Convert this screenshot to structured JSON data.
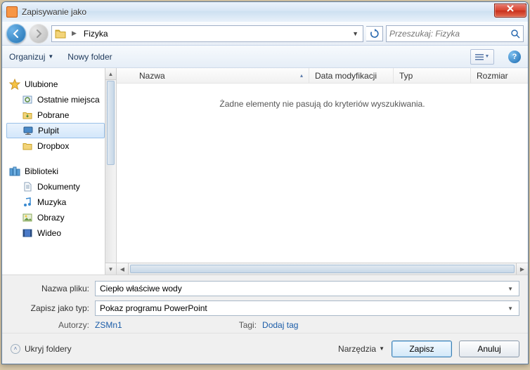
{
  "window": {
    "title": "Zapisywanie jako"
  },
  "address": {
    "path": "Fizyka"
  },
  "search": {
    "placeholder": "Przeszukaj: Fizyka"
  },
  "toolbar": {
    "organize": "Organizuj",
    "new_folder": "Nowy folder"
  },
  "sidebar": {
    "favorites": {
      "label": "Ulubione",
      "items": [
        "Ostatnie miejsca",
        "Pobrane",
        "Pulpit",
        "Dropbox"
      ]
    },
    "libraries": {
      "label": "Biblioteki",
      "items": [
        "Dokumenty",
        "Muzyka",
        "Obrazy",
        "Wideo"
      ]
    }
  },
  "columns": {
    "name": "Nazwa",
    "modified": "Data modyfikacji",
    "type": "Typ",
    "size": "Rozmiar"
  },
  "listing": {
    "empty_message": "Żadne elementy nie pasują do kryteriów wyszukiwania."
  },
  "form": {
    "filename_label": "Nazwa pliku:",
    "filename_value": "Ciepło właściwe wody",
    "filetype_label": "Zapisz jako typ:",
    "filetype_value": "Pokaz programu PowerPoint",
    "authors_label": "Autorzy:",
    "authors_value": "ZSMn1",
    "tags_label": "Tagi:",
    "tags_value": "Dodaj tag"
  },
  "footer": {
    "hide_folders": "Ukryj foldery",
    "tools": "Narzędzia",
    "save": "Zapisz",
    "cancel": "Anuluj"
  }
}
